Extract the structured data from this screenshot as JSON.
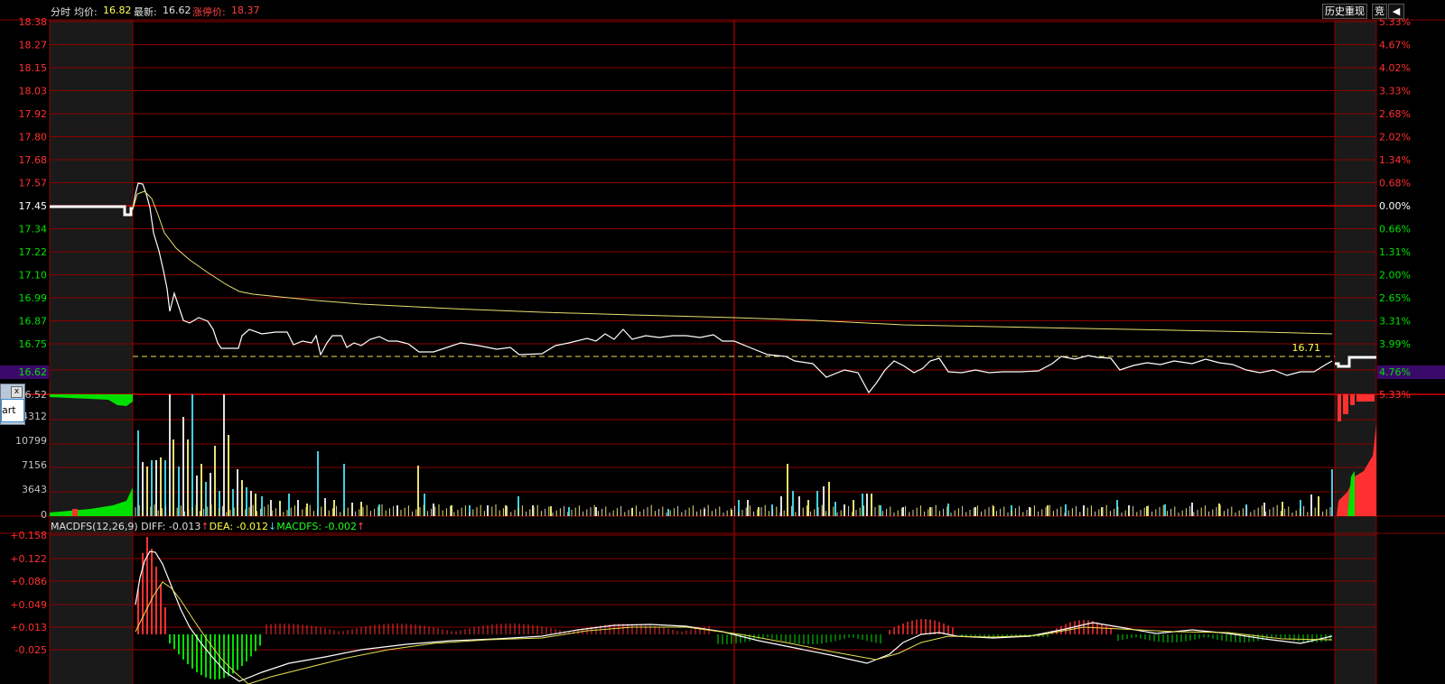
{
  "header": {
    "mode_label": "分时",
    "avg_label": "均价:",
    "avg_value": "16.82",
    "last_label": "最新:",
    "last_value": "16.62",
    "limit_label": "涨停价:",
    "limit_value": "18.37",
    "history_button": "历史重现",
    "auction_button": "竞"
  },
  "price_axis": {
    "left_labels": [
      "18.38",
      "18.27",
      "18.15",
      "18.03",
      "17.92",
      "17.80",
      "17.68",
      "17.57",
      "17.45",
      "17.34",
      "17.22",
      "17.10",
      "16.99",
      "16.87",
      "16.75"
    ],
    "right_labels": [
      "5.33%",
      "4.67%",
      "4.02%",
      "3.33%",
      "2.68%",
      "2.02%",
      "1.34%",
      "0.68%",
      "0.00%",
      "0.66%",
      "1.31%",
      "2.00%",
      "2.65%",
      "3.31%",
      "3.99%"
    ],
    "current_left": "16.62",
    "current_right": "4.76%",
    "limit_pct_right": "5.33%",
    "dashed_line_label": "16.71"
  },
  "volume_axis": {
    "labels": [
      "14312",
      "10799",
      "7156",
      "3643",
      "0"
    ],
    "left_partial_top": "16.52"
  },
  "macd": {
    "title": "MACDFS(12,26,9)",
    "diff_label": "DIFF:",
    "diff_value": "-0.013",
    "dea_label": "DEA:",
    "dea_value": "-0.012",
    "macdfs_label": "MACDFS:",
    "macdfs_value": "-0.002",
    "axis_labels": [
      "+0.158",
      "+0.122",
      "+0.086",
      "+0.049",
      "+0.013",
      "-0.025"
    ]
  },
  "popup": {
    "close": "x",
    "button": "art"
  },
  "colors": {
    "grid": "#8c0000",
    "price_line": "#ffffff",
    "avg_line": "#e8e070",
    "up": "#ff3030",
    "down": "#00e000",
    "cyan": "#40d0e0",
    "yellow": "#ffff40"
  }
}
